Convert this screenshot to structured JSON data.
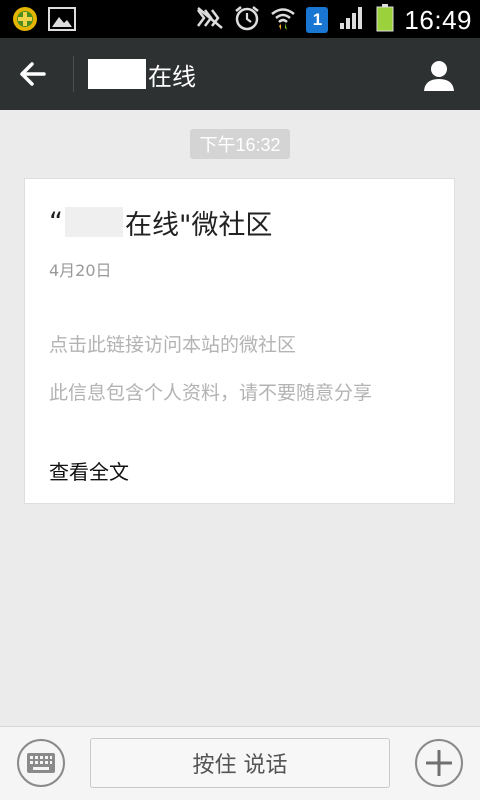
{
  "status_bar": {
    "time": "16:49",
    "notification_badge": "1",
    "icons": [
      "app-notification-icon",
      "image-notification-icon",
      "mute-icon",
      "alarm-icon",
      "wifi-icon",
      "sim-badge-icon",
      "signal-icon",
      "battery-icon"
    ]
  },
  "header": {
    "title_suffix": "在线",
    "icons": {
      "back": "arrow-left-icon",
      "profile": "person-icon"
    }
  },
  "chat": {
    "timestamp": "下午16:32",
    "card": {
      "title_open_quote": "“",
      "title_suffix": "在线\"微社区",
      "date": "4月20日",
      "desc_line1": "点击此链接访问本站的微社区",
      "desc_line2": "此信息包含个人资料，请不要随意分享",
      "link_label": "查看全文"
    }
  },
  "input_bar": {
    "hold_to_talk_label": "按住 说话",
    "icons": {
      "keyboard": "keyboard-icon",
      "more": "plus-icon"
    }
  },
  "colors": {
    "status_bar_bg": "#000000",
    "header_bg": "#2e3132",
    "chat_bg": "#ebebeb",
    "battery_green": "#9bd13a",
    "badge_blue": "#1976d2"
  }
}
